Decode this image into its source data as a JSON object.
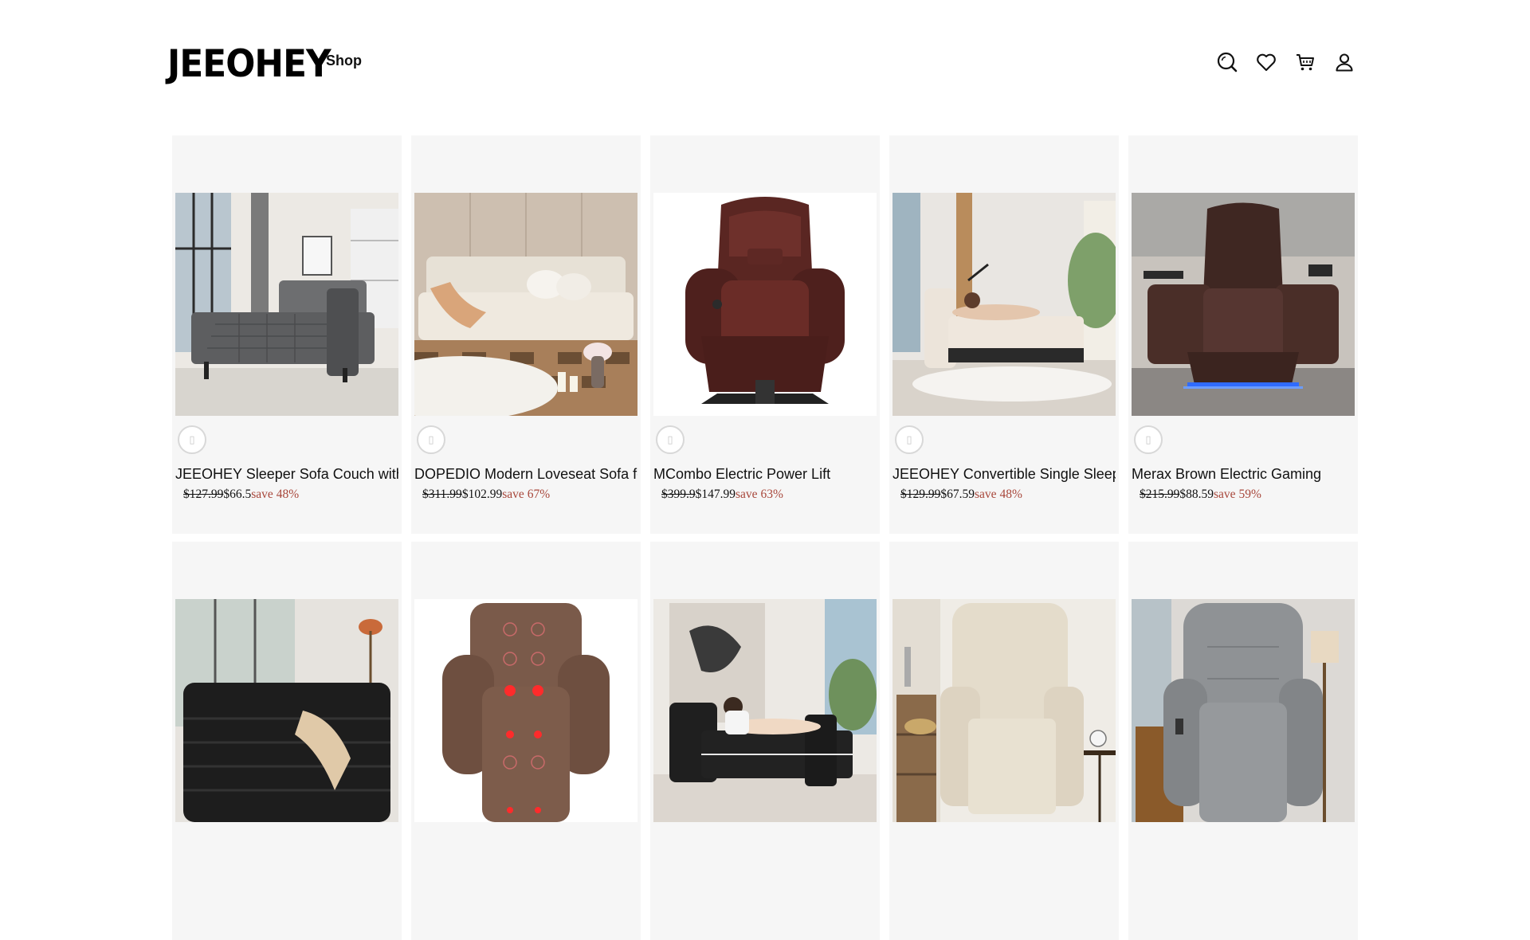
{
  "header": {
    "logo_text": "JEEOHEY",
    "nav": [
      {
        "label": "Shop"
      }
    ],
    "icons": [
      "search-icon",
      "heart-icon",
      "cart-icon",
      "user-icon"
    ]
  },
  "products": [
    {
      "title": "JEEOHEY Sleeper Sofa Couch with",
      "original_price": "$127.99",
      "sale_price": "$66.5",
      "save_label": "save",
      "save_pct": "48%",
      "image": "gray-sleeper-sofa"
    },
    {
      "title": "DOPEDIO Modern Loveseat Sofa for",
      "original_price": "$311.99",
      "sale_price": "$102.99",
      "save_label": "save",
      "save_pct": "67%",
      "image": "cream-loveseat"
    },
    {
      "title": "MCombo Electric Power Lift",
      "original_price": "$399.9",
      "sale_price": "$147.99",
      "save_label": "save",
      "save_pct": "63%",
      "image": "brown-lift-recliner"
    },
    {
      "title": "JEEOHEY Convertible Single Sleeper",
      "original_price": "$129.99",
      "sale_price": "$67.59",
      "save_label": "save",
      "save_pct": "48%",
      "image": "cream-sleeper-chair"
    },
    {
      "title": "Merax Brown Electric Gaming",
      "original_price": "$215.99",
      "sale_price": "$88.59",
      "save_label": "save",
      "save_pct": "59%",
      "image": "brown-gaming-recliner"
    },
    {
      "title": "",
      "original_price": "",
      "sale_price": "",
      "save_label": "",
      "save_pct": "",
      "image": "black-fur-chaise"
    },
    {
      "title": "",
      "original_price": "",
      "sale_price": "",
      "save_label": "",
      "save_pct": "",
      "image": "brown-massage-recliner"
    },
    {
      "title": "",
      "original_price": "",
      "sale_price": "",
      "save_label": "",
      "save_pct": "",
      "image": "black-pullout-sofa"
    },
    {
      "title": "",
      "original_price": "",
      "sale_price": "",
      "save_label": "",
      "save_pct": "",
      "image": "beige-recliner"
    },
    {
      "title": "",
      "original_price": "",
      "sale_price": "",
      "save_label": "",
      "save_pct": "",
      "image": "gray-lift-recliner"
    }
  ]
}
